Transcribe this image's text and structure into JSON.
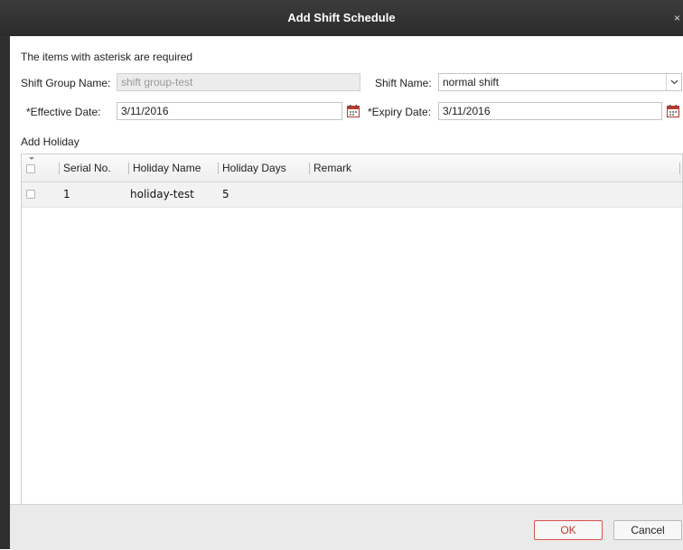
{
  "dialog": {
    "title": "Add Shift Schedule",
    "close_glyph": "×"
  },
  "form": {
    "required_note": "The items with asterisk are required",
    "shift_group_name_label": "Shift Group Name:",
    "shift_group_name_value": "shift group-test",
    "shift_name_label": "Shift Name:",
    "shift_name_value": "normal shift",
    "effective_date_label": "*Effective Date:",
    "effective_date_value": "3/11/2016",
    "expiry_date_label": "*Expiry Date:",
    "expiry_date_value": "3/11/2016"
  },
  "holiday": {
    "section_label": "Add Holiday",
    "columns": [
      "Serial No.",
      "Holiday Name",
      "Holiday Days",
      "Remark"
    ],
    "rows": [
      {
        "serial": "1",
        "name": "holiday-test",
        "days": "5",
        "remark": ""
      }
    ]
  },
  "footer": {
    "ok_label": "OK",
    "cancel_label": "Cancel"
  },
  "colors": {
    "titlebar": "#2f2f2f",
    "accent_ok": "#d9534f",
    "calendar_icon": "#c0392b"
  }
}
